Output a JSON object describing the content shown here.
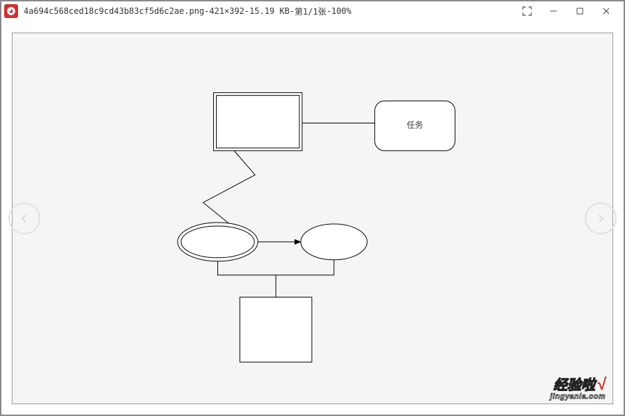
{
  "window": {
    "filename": "4a694c568ced18c9cd43b83cf5d6c2ae.png",
    "dimensions": "421×392",
    "filesize": "15.19 KB",
    "page_indicator": "第1/1张",
    "zoom": "100%",
    "title_sep": " - "
  },
  "diagram": {
    "task_label": "任务"
  },
  "watermark": {
    "line1": "经验啦",
    "check": "√",
    "line2": "jingyanla.com"
  }
}
